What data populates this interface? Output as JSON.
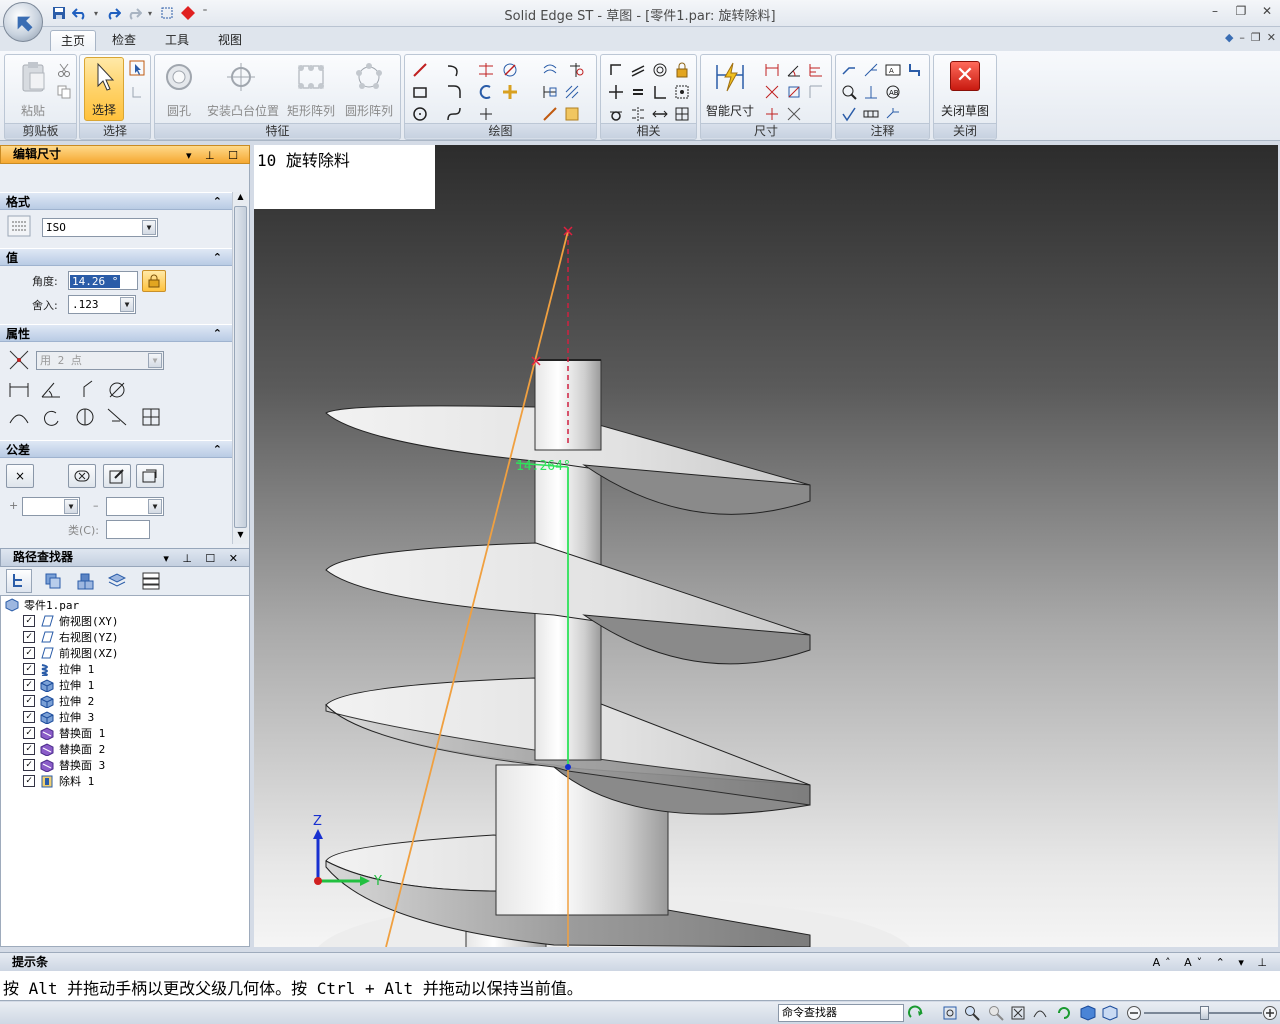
{
  "window": {
    "title": "Solid Edge ST - 草图 - [零件1.par: 旋转除料]"
  },
  "tabs": [
    {
      "label": "主页",
      "active": true
    },
    {
      "label": "检查",
      "active": false
    },
    {
      "label": "工具",
      "active": false
    },
    {
      "label": "视图",
      "active": false
    }
  ],
  "ribbon": {
    "clipboard": {
      "label": "剪贴板",
      "paste": "粘贴"
    },
    "select": {
      "label": "选择",
      "select": "选择"
    },
    "features": {
      "label": "特征",
      "hole": "圆孔",
      "boss": "安装凸台位置",
      "rect_pattern": "矩形阵列",
      "circ_pattern": "圆形阵列"
    },
    "draw": {
      "label": "绘图"
    },
    "relate": {
      "label": "相关"
    },
    "dimension": {
      "label": "尺寸",
      "smart": "智能尺寸"
    },
    "annotation": {
      "label": "注释"
    },
    "close": {
      "label": "关闭",
      "close_sketch": "关闭草图"
    }
  },
  "edit_panel": {
    "title": "编辑尺寸",
    "format": {
      "title": "格式",
      "standard": "ISO"
    },
    "value": {
      "title": "值",
      "angle_label": "角度:",
      "angle_value": "14.26 °",
      "round_label": "舍入:",
      "round_value": ".123"
    },
    "properties": {
      "title": "属性",
      "mode": "用 2 点"
    },
    "tolerance": {
      "title": "公差",
      "plus": "+",
      "minus": "–",
      "class_label": "类(C):"
    }
  },
  "pathfinder": {
    "title": "路径查找器",
    "root": "零件1.par",
    "items": [
      {
        "label": "俯视图(XY)",
        "checked": true,
        "icon": "plane-icon"
      },
      {
        "label": "右视图(YZ)",
        "checked": true,
        "icon": "plane-icon"
      },
      {
        "label": "前视图(XZ)",
        "checked": true,
        "icon": "plane-icon"
      },
      {
        "label": "拉伸 1",
        "checked": true,
        "icon": "helix-icon"
      },
      {
        "label": "拉伸 1",
        "checked": true,
        "icon": "extrude-icon"
      },
      {
        "label": "拉伸 2",
        "checked": true,
        "icon": "extrude-icon"
      },
      {
        "label": "拉伸 3",
        "checked": true,
        "icon": "extrude-icon"
      },
      {
        "label": "替换面 1",
        "checked": true,
        "icon": "replace-face-icon"
      },
      {
        "label": "替换面 2",
        "checked": true,
        "icon": "replace-face-icon"
      },
      {
        "label": "替换面 3",
        "checked": true,
        "icon": "replace-face-icon"
      },
      {
        "label": "除料 1",
        "checked": true,
        "icon": "cutout-icon"
      }
    ]
  },
  "viewport": {
    "step": "10 旋转除料",
    "dimension_label": "14.264°",
    "axis_z": "Z",
    "axis_y": "Y"
  },
  "prompt": {
    "title": "提示条",
    "text": "按 Alt 并拖动手柄以更改父级几何体。按 Ctrl + Alt 并拖动以保持当前值。"
  },
  "statusbar": {
    "command_finder": "命令查找器"
  },
  "colors": {
    "accent_orange": "#f5a832",
    "sketch_orange": "#f0a040",
    "dimension_green": "#2ee35a",
    "close_red": "#d82020"
  }
}
